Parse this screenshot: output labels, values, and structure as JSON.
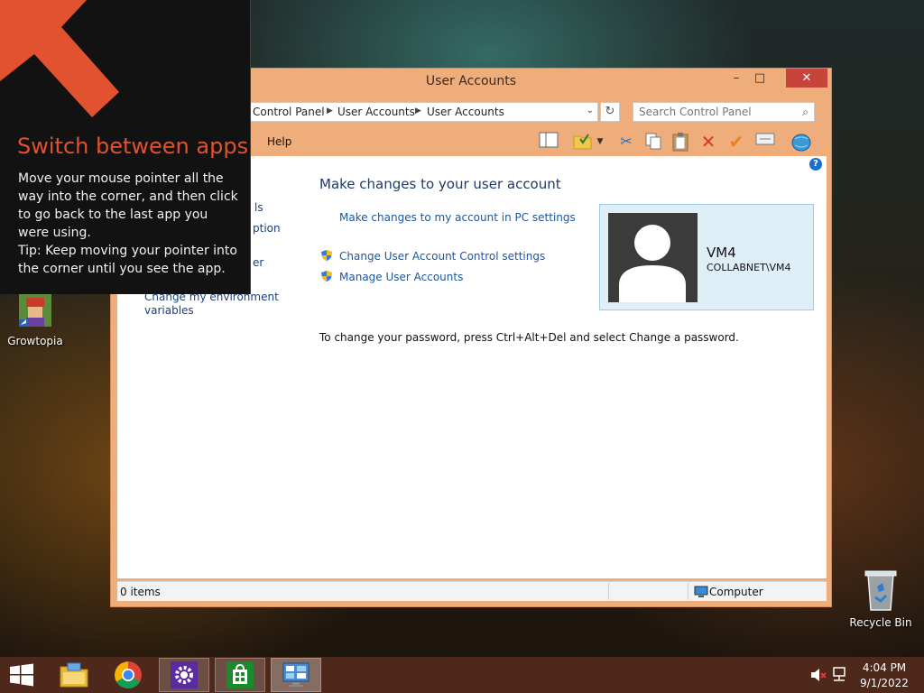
{
  "window": {
    "title": "User Accounts",
    "min_label": "–",
    "max_label": "□",
    "close_label": "✕"
  },
  "address": {
    "crumbs": [
      "Control Panel",
      "User Accounts",
      "User Accounts"
    ],
    "separator": "▶",
    "dropdown": "⌄",
    "refresh": "↻"
  },
  "search": {
    "placeholder": "Search Control Panel",
    "icon": "⌕"
  },
  "menu": {
    "help": "Help"
  },
  "toolbar": {
    "icons": [
      "layout-pane-icon",
      "folder-check-icon",
      "dropdown-arrow-icon",
      "cut-icon",
      "copy-icon",
      "paste-icon",
      "delete-icon",
      "checkmark-icon",
      "rename-icon",
      "globe-icon"
    ]
  },
  "sidebar": {
    "items": [
      "ls",
      "ption",
      "er",
      "Change my environment",
      "variables"
    ]
  },
  "main": {
    "heading": "Make changes to your user account",
    "pc_settings_link": "Make changes to my account in PC settings",
    "uac_link": "Change User Account Control settings",
    "manage_link": "Manage User Accounts",
    "password_note": "To change your password, press Ctrl+Alt+Del and select Change a password."
  },
  "user": {
    "name": "VM4",
    "domain": "COLLABNET\\VM4"
  },
  "status": {
    "items": "0 items",
    "location": "Computer"
  },
  "tip": {
    "title": "Switch between apps",
    "line1": "Move your mouse pointer all the way into the corner, and then click to go back to the last app you were using.",
    "line2": "Tip: Keep moving your pointer into the corner until you see the app."
  },
  "desktop": {
    "growtopia": "Growtopia",
    "recycle": "Recycle Bin"
  },
  "taskbar": {
    "time": "4:04 PM",
    "date": "9/1/2022"
  },
  "colors": {
    "accent": "#e2522f",
    "window_frame": "#f0ad7c",
    "taskbar": "#4d281b",
    "link": "#1e56a0"
  }
}
